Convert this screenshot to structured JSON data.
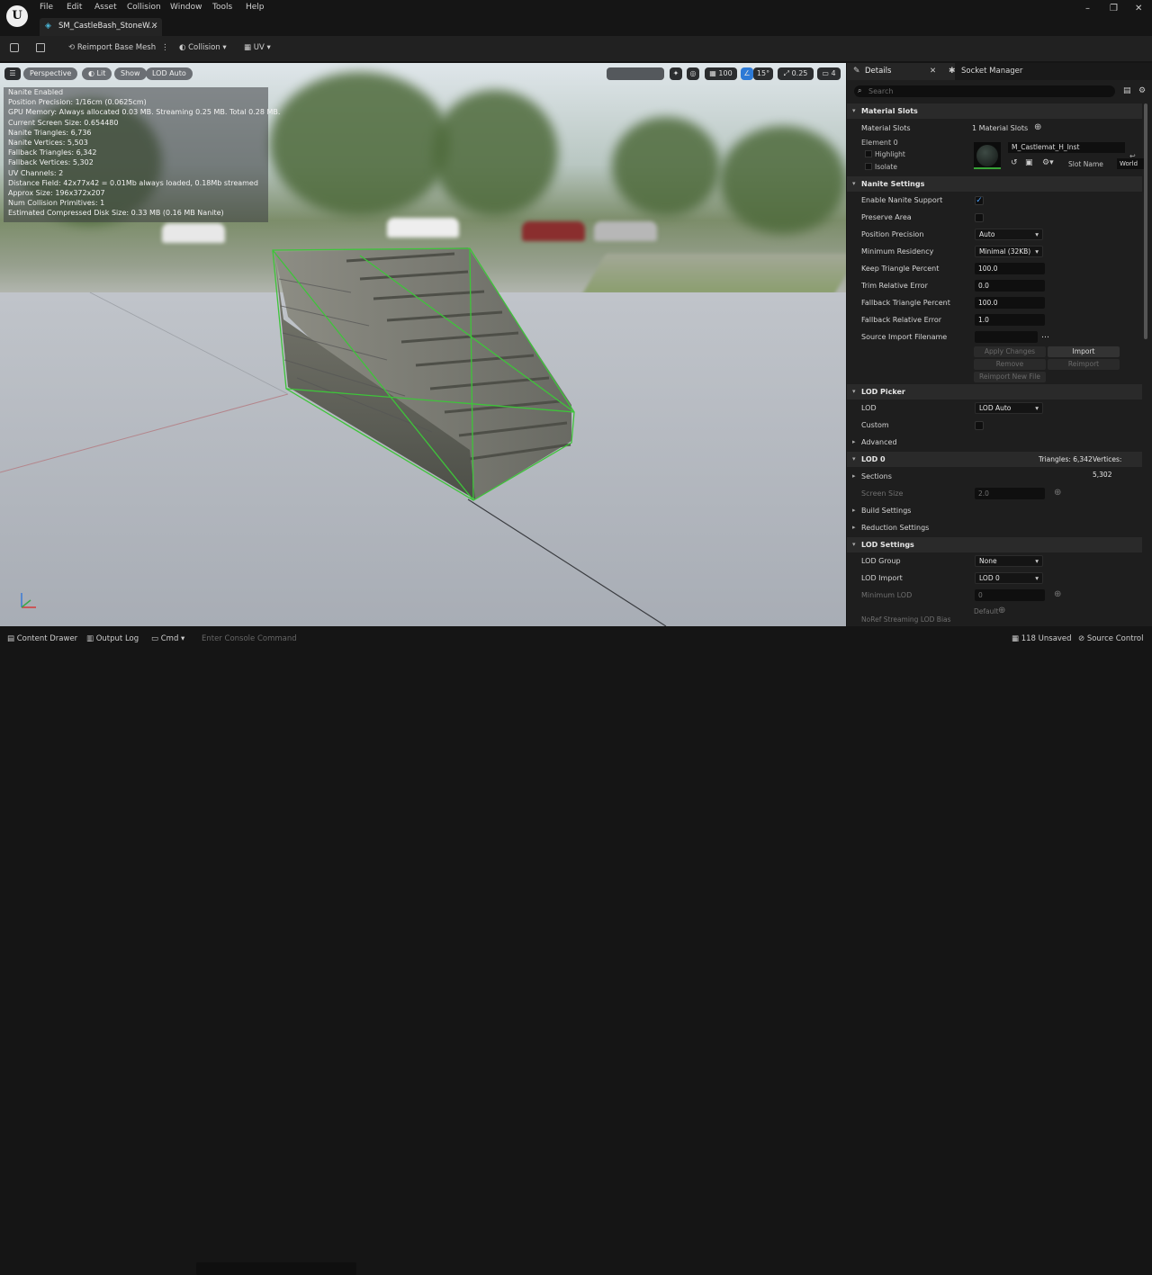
{
  "menu": [
    "File",
    "Edit",
    "Asset",
    "Collision",
    "Window",
    "Tools",
    "Help"
  ],
  "tab_title": "SM_CastleBash_StoneW...",
  "toolbar": {
    "reimport": "Reimport Base Mesh",
    "collision": "Collision",
    "uv": "UV"
  },
  "viewport": {
    "perspective": "Perspective",
    "lit": "Lit",
    "show": "Show",
    "lod": "LOD Auto",
    "grid_snap": "100",
    "rot_snap": "15°",
    "scale_snap": "0.25",
    "cam_speed": "4",
    "stats": [
      "Nanite Enabled",
      "Position Precision: 1/16cm (0.0625cm)",
      "GPU Memory: Always allocated 0.03 MB. Streaming 0.25 MB. Total 0.28 MB.",
      "Current Screen Size: 0.654480",
      "Nanite Triangles: 6,736",
      "Nanite Vertices: 5,503",
      "Fallback Triangles: 6,342",
      "Fallback Vertices: 5,302",
      "UV Channels: 2",
      "Distance Field: 42x77x42 = 0.01Mb always loaded, 0.18Mb streamed",
      "Approx Size: 196x372x207",
      "Num Collision Primitives: 1",
      "Estimated Compressed Disk Size: 0.33 MB (0.16 MB Nanite)"
    ]
  },
  "panel": {
    "details_tab": "Details",
    "socket_tab": "Socket Manager",
    "search_placeholder": "Search",
    "material_slots": {
      "section": "Material Slots",
      "label": "Material Slots",
      "count": "1 Material Slots",
      "element": "Element 0",
      "highlight": "Highlight",
      "isolate": "Isolate",
      "material": "M_Castlemat_H_Inst",
      "slot_name_label": "Slot Name",
      "slot_name_value": "World"
    },
    "nanite": {
      "section": "Nanite Settings",
      "enable": "Enable Nanite Support",
      "preserve": "Preserve Area",
      "position_precision": "Position Precision",
      "position_precision_value": "Auto",
      "min_residency": "Minimum Residency",
      "min_residency_value": "Minimal (32KB)",
      "keep_tri": "Keep Triangle Percent",
      "keep_tri_value": "100.0",
      "trim": "Trim Relative Error",
      "trim_value": "0.0",
      "fallback_tri": "Fallback Triangle Percent",
      "fallback_tri_value": "100.0",
      "fallback_err": "Fallback Relative Error",
      "fallback_err_value": "1.0",
      "source": "Source Import Filename",
      "apply": "Apply Changes",
      "import": "Import",
      "remove": "Remove",
      "reimport": "Reimport",
      "reimport_new": "Reimport New File"
    },
    "lod_picker": {
      "section": "LOD Picker",
      "lod": "LOD",
      "lod_value": "LOD Auto",
      "custom": "Custom",
      "advanced": "Advanced"
    },
    "lod0": {
      "section": "LOD 0",
      "triangles": "Triangles: 6,342",
      "vertices": "Vertices: 5,302",
      "sections": "Sections",
      "screen_size": "Screen Size",
      "screen_size_value": "2.0",
      "build": "Build Settings",
      "reduction": "Reduction Settings"
    },
    "lod_settings": {
      "section": "LOD Settings",
      "group": "LOD Group",
      "group_value": "None",
      "import": "LOD Import",
      "import_value": "LOD 0",
      "min_lod": "Minimum LOD",
      "min_lod_value": "0",
      "default": "Default",
      "noref": "NoRef Streaming LOD Bias"
    }
  },
  "statusbar": {
    "content_drawer": "Content Drawer",
    "output_log": "Output Log",
    "cmd": "Cmd",
    "console_placeholder": "Enter Console Command",
    "unsaved": "118 Unsaved",
    "source_control": "Source Control"
  }
}
